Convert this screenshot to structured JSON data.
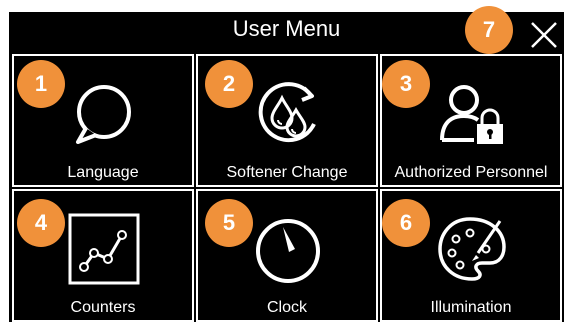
{
  "title": "User Menu",
  "badge_color": "#f0913a",
  "close_icon": "close-icon",
  "close_badge": "7",
  "tiles": [
    {
      "badge": "1",
      "label": "Language",
      "icon": "speech-bubble-icon"
    },
    {
      "badge": "2",
      "label": "Softener Change",
      "icon": "water-drops-refresh-icon"
    },
    {
      "badge": "3",
      "label": "Authorized Personnel",
      "icon": "user-lock-icon"
    },
    {
      "badge": "4",
      "label": "Counters",
      "icon": "line-chart-icon"
    },
    {
      "badge": "5",
      "label": "Clock",
      "icon": "clock-icon"
    },
    {
      "badge": "6",
      "label": "Illumination",
      "icon": "palette-icon"
    }
  ]
}
